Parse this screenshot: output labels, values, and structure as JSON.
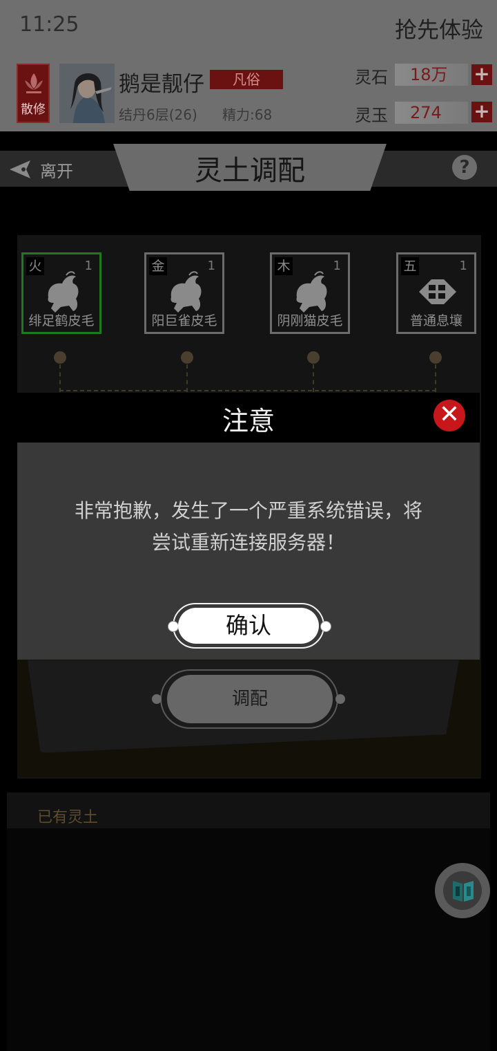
{
  "status": {
    "time": "11:25",
    "right_label": "抢先体验"
  },
  "player": {
    "sect_label": "散修",
    "name": "鹅是靓仔",
    "rank": "凡俗",
    "realm": "结丹6层(26)",
    "energy": "精力:68"
  },
  "currencies": [
    {
      "label": "灵石",
      "value": "18万",
      "add": "+"
    },
    {
      "label": "灵玉",
      "value": "274",
      "add": "+"
    }
  ],
  "titlebar": {
    "leave": "离开",
    "title": "灵土调配",
    "help": "?"
  },
  "slots": [
    {
      "element": "火",
      "qty": "1",
      "name": "绯足鹤皮毛",
      "selected": true,
      "icon": "pelt-icon"
    },
    {
      "element": "金",
      "qty": "1",
      "name": "阳巨雀皮毛",
      "selected": false,
      "icon": "pelt-icon"
    },
    {
      "element": "木",
      "qty": "1",
      "name": "阴刚猫皮毛",
      "selected": false,
      "icon": "pelt-icon"
    },
    {
      "element": "五",
      "qty": "1",
      "name": "普通息壤",
      "selected": false,
      "icon": "soil-icon"
    }
  ],
  "mix_button": "调配",
  "owned_label": "已有灵土",
  "dialog": {
    "title": "注意",
    "close": "✕",
    "message_line1": "非常抱歉，发生了一个严重系统错误，将",
    "message_line2": "尝试重新连接服务器！",
    "confirm": "确认"
  },
  "colors": {
    "accent_red": "#c8171b",
    "selected_green": "#1f7a1f",
    "dark_red": "#6a1212"
  }
}
